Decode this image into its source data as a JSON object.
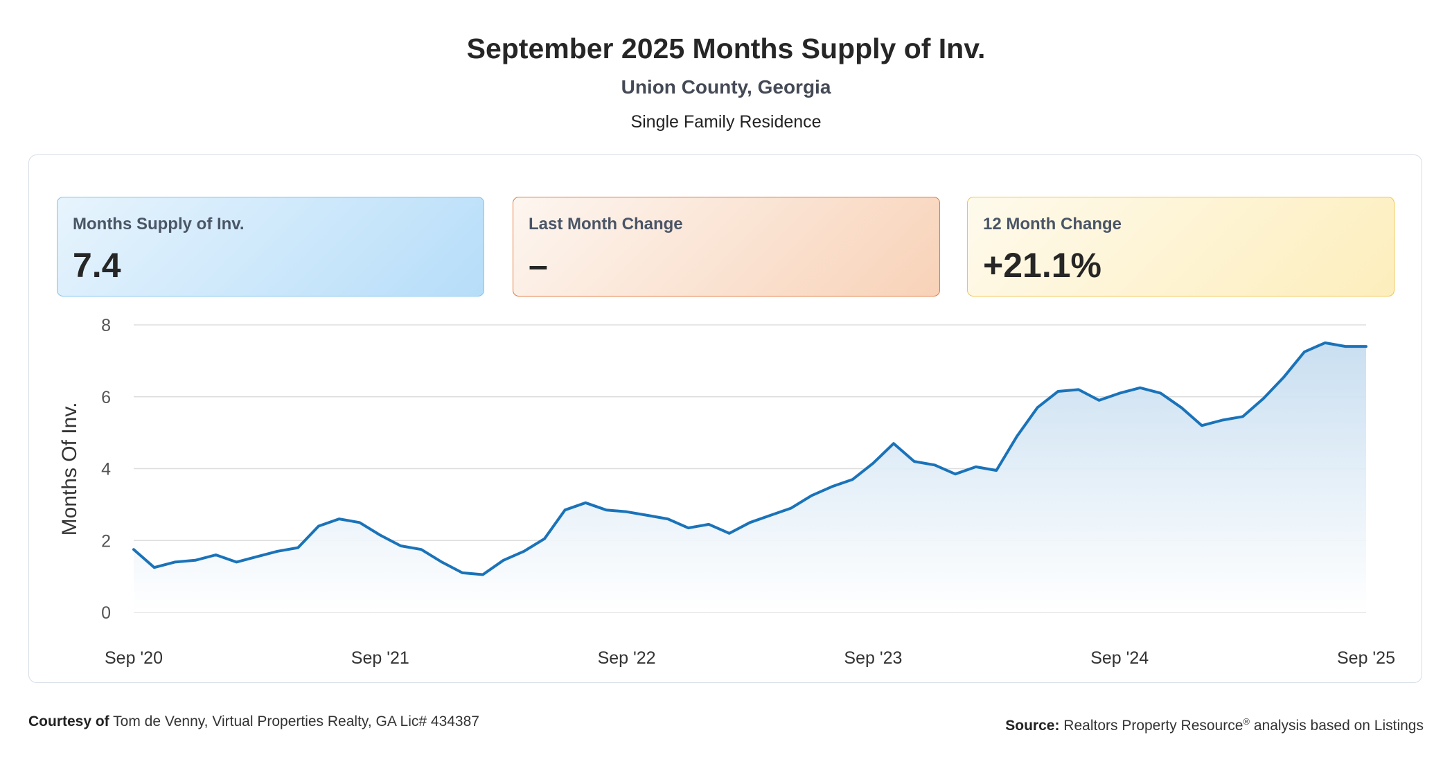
{
  "header": {
    "title": "September 2025 Months Supply of Inv.",
    "subtitle": "Union County, Georgia",
    "property_type": "Single Family Residence"
  },
  "cards": {
    "supply": {
      "label": "Months Supply of Inv.",
      "value": "7.4"
    },
    "last_month": {
      "label": "Last Month Change",
      "value": "–"
    },
    "twelve_month": {
      "label": "12 Month Change",
      "value": "+21.1%"
    }
  },
  "footer": {
    "courtesy_label": "Courtesy of",
    "courtesy_text": "Tom de Venny, Virtual Properties Realty, GA Lic# 434387",
    "source_label": "Source:",
    "source_text_a": "Realtors Property Resource",
    "source_reg": "®",
    "source_text_b": " analysis based on Listings"
  },
  "colors": {
    "line": "#1a73b9",
    "area_top": "#c6ddf0",
    "area_bottom": "#ffffff",
    "grid": "#dddddd"
  },
  "chart_data": {
    "type": "area",
    "ylabel": "Months Of Inv.",
    "ylim": [
      0,
      8
    ],
    "yticks": [
      0,
      2,
      4,
      6,
      8
    ],
    "xtick_labels": [
      "Sep '20",
      "Sep '21",
      "Sep '22",
      "Sep '23",
      "Sep '24",
      "Sep '25"
    ],
    "xtick_indices": [
      0,
      12,
      24,
      36,
      48,
      60
    ],
    "grid": true,
    "legend": "none",
    "series": [
      {
        "values": [
          1.75,
          1.25,
          1.4,
          1.45,
          1.6,
          1.4,
          1.55,
          1.7,
          1.8,
          2.4,
          2.6,
          2.5,
          2.15,
          1.85,
          1.75,
          1.4,
          1.1,
          1.05,
          1.45,
          1.7,
          2.05,
          2.85,
          3.05,
          2.85,
          2.8,
          2.7,
          2.6,
          2.35,
          2.45,
          2.2,
          2.5,
          2.7,
          2.9,
          3.25,
          3.5,
          3.7,
          4.15,
          4.7,
          4.2,
          4.1,
          3.85,
          4.05,
          3.95,
          4.9,
          5.7,
          6.15,
          6.2,
          5.9,
          6.1,
          6.25,
          6.1,
          5.7,
          5.2,
          5.35,
          5.45,
          5.95,
          6.55,
          7.25,
          7.5,
          7.4,
          7.4
        ]
      }
    ]
  }
}
